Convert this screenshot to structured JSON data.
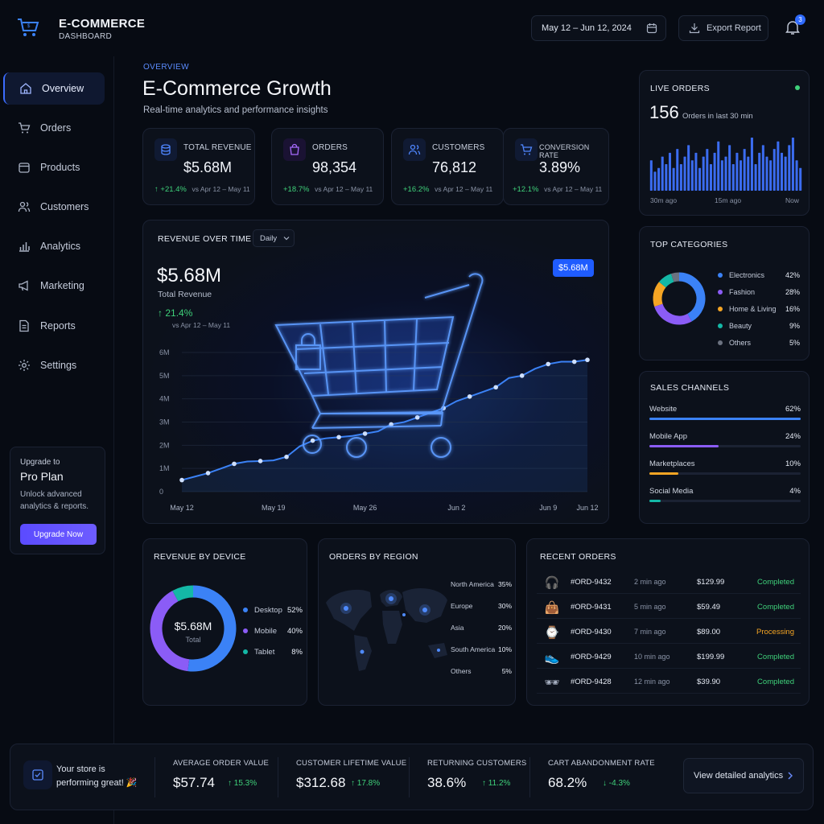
{
  "header": {
    "brand": "E-COMMERCE",
    "brand_sub": "DASHBOARD",
    "date_range": "May 12 – Jun 12, 2024",
    "export_label": "Export Report",
    "notif_count": "3"
  },
  "sidebar": {
    "items": [
      {
        "label": "Overview",
        "icon": "home-icon"
      },
      {
        "label": "Orders",
        "icon": "cart-icon"
      },
      {
        "label": "Products",
        "icon": "box-icon"
      },
      {
        "label": "Customers",
        "icon": "users-icon"
      },
      {
        "label": "Analytics",
        "icon": "bar-chart-icon"
      },
      {
        "label": "Marketing",
        "icon": "megaphone-icon"
      },
      {
        "label": "Reports",
        "icon": "document-icon"
      },
      {
        "label": "Settings",
        "icon": "gear-icon"
      }
    ],
    "promo": {
      "line1": "Upgrade to",
      "title": "Pro Plan",
      "desc1": "Unlock advanced",
      "desc2": "analytics & reports.",
      "button": "Upgrade Now"
    }
  },
  "overview": {
    "eyebrow": "OVERVIEW",
    "title": "E-Commerce Growth",
    "subtitle": "Real-time analytics and performance insights"
  },
  "kpis": [
    {
      "label": "TOTAL REVENUE",
      "value": "$5.68M",
      "change": "+21.4%",
      "period": "vs Apr 12 – May 11",
      "icon": "coins-icon",
      "color": "#3b82f6"
    },
    {
      "label": "ORDERS",
      "value": "98,354",
      "change": "+18.7%",
      "period": "vs Apr 12 – May 11",
      "icon": "bag-icon",
      "color": "#a855f7"
    },
    {
      "label": "CUSTOMERS",
      "value": "76,812",
      "change": "+16.2%",
      "period": "vs Apr 12 – May 11",
      "icon": "users-icon",
      "color": "#3b82f6"
    },
    {
      "label": "CONVERSION RATE",
      "value": "3.89%",
      "change": "+12.1%",
      "period": "vs Apr 12 – May 11",
      "icon": "cart-icon",
      "color": "#3b82f6"
    }
  ],
  "revenue": {
    "title": "REVENUE OVER TIME",
    "dropdown": "Daily",
    "value": "$5.68M",
    "value_label": "Total Revenue",
    "change": "21.4%",
    "period": "vs Apr 12 – May 11",
    "tooltip": "$5.68M"
  },
  "chart_data": {
    "type": "line",
    "title": "REVENUE OVER TIME",
    "x": [
      "May 12",
      "May 13",
      "May 14",
      "May 15",
      "May 16",
      "May 17",
      "May 18",
      "May 19",
      "May 20",
      "May 21",
      "May 22",
      "May 23",
      "May 24",
      "May 25",
      "May 26",
      "May 27",
      "May 28",
      "May 29",
      "May 30",
      "May 31",
      "Jun 1",
      "Jun 2",
      "Jun 3",
      "Jun 4",
      "Jun 5",
      "Jun 6",
      "Jun 7",
      "Jun 8",
      "Jun 9",
      "Jun 10",
      "Jun 11",
      "Jun 12"
    ],
    "y": [
      0.5,
      0.65,
      0.8,
      1.0,
      1.2,
      1.3,
      1.32,
      1.35,
      1.5,
      1.95,
      2.2,
      2.3,
      2.35,
      2.4,
      2.5,
      2.6,
      2.9,
      3.0,
      3.2,
      3.4,
      3.6,
      3.9,
      4.1,
      4.3,
      4.5,
      4.9,
      5.0,
      5.3,
      5.5,
      5.6,
      5.6,
      5.68
    ],
    "x_ticks": [
      "May 12",
      "May 19",
      "May 26",
      "Jun 2",
      "Jun 9",
      "Jun 12"
    ],
    "y_ticks": [
      "0",
      "1M",
      "2M",
      "3M",
      "4M",
      "5M",
      "6M"
    ],
    "ylim": [
      0,
      6
    ],
    "xlabel": "",
    "ylabel": "",
    "grid": true,
    "color": "#3b82f6"
  },
  "live_orders": {
    "title": "LIVE ORDERS",
    "count": "156",
    "count_label": "Orders in last 30 min",
    "bars": [
      8,
      5,
      6,
      9,
      7,
      10,
      6,
      11,
      7,
      9,
      12,
      8,
      10,
      6,
      9,
      11,
      7,
      10,
      13,
      8,
      9,
      12,
      7,
      10,
      8,
      11,
      9,
      14,
      7,
      10,
      12,
      9,
      8,
      11,
      13,
      10,
      9,
      12,
      14,
      8,
      6
    ],
    "x_labels": [
      "30m ago",
      "15m ago",
      "Now"
    ]
  },
  "top_categories": {
    "title": "TOP CATEGORIES",
    "items": [
      {
        "name": "Electronics",
        "pct": "42%",
        "value": 42,
        "color": "#3b82f6"
      },
      {
        "name": "Fashion",
        "pct": "28%",
        "value": 28,
        "color": "#8b5cf6"
      },
      {
        "name": "Home & Living",
        "pct": "16%",
        "value": 16,
        "color": "#f5a524"
      },
      {
        "name": "Beauty",
        "pct": "9%",
        "value": 9,
        "color": "#14b8a6"
      },
      {
        "name": "Others",
        "pct": "5%",
        "value": 5,
        "color": "#6b7280"
      }
    ]
  },
  "sales_channels": {
    "title": "SALES CHANNELS",
    "items": [
      {
        "name": "Website",
        "pct": "62%",
        "value": 62,
        "color": "#3b82f6"
      },
      {
        "name": "Mobile App",
        "pct": "24%",
        "value": 24,
        "color": "#8b5cf6"
      },
      {
        "name": "Marketplaces",
        "pct": "10%",
        "value": 10,
        "color": "#f5a524"
      },
      {
        "name": "Social Media",
        "pct": "4%",
        "value": 4,
        "color": "#14b8a6"
      }
    ]
  },
  "revenue_by_device": {
    "title": "REVENUE BY DEVICE",
    "center_value": "$5.68M",
    "center_label": "Total",
    "items": [
      {
        "name": "Desktop",
        "pct": "52%",
        "value": 52,
        "color": "#3b82f6"
      },
      {
        "name": "Mobile",
        "pct": "40%",
        "value": 40,
        "color": "#8b5cf6"
      },
      {
        "name": "Tablet",
        "pct": "8%",
        "value": 8,
        "color": "#14b8a6"
      }
    ]
  },
  "orders_by_region": {
    "title": "ORDERS BY REGION",
    "items": [
      {
        "name": "North America",
        "pct": "35%"
      },
      {
        "name": "Europe",
        "pct": "30%"
      },
      {
        "name": "Asia",
        "pct": "20%"
      },
      {
        "name": "South America",
        "pct": "10%"
      },
      {
        "name": "Others",
        "pct": "5%"
      }
    ]
  },
  "recent_orders": {
    "title": "RECENT ORDERS",
    "rows": [
      {
        "id": "#ORD-9432",
        "time": "2 min ago",
        "amount": "$129.99",
        "status": "Completed",
        "status_color": "#3fd17a",
        "icon": "headphones-icon"
      },
      {
        "id": "#ORD-9431",
        "time": "5 min ago",
        "amount": "$59.49",
        "status": "Completed",
        "status_color": "#3fd17a",
        "icon": "shopping-bag-icon"
      },
      {
        "id": "#ORD-9430",
        "time": "7 min ago",
        "amount": "$89.00",
        "status": "Processing",
        "status_color": "#f5a524",
        "icon": "watch-icon"
      },
      {
        "id": "#ORD-9429",
        "time": "10 min ago",
        "amount": "$199.99",
        "status": "Completed",
        "status_color": "#3fd17a",
        "icon": "sneaker-icon"
      },
      {
        "id": "#ORD-9428",
        "time": "12 min ago",
        "amount": "$39.90",
        "status": "Completed",
        "status_color": "#3fd17a",
        "icon": "sunglasses-icon"
      }
    ]
  },
  "footer": {
    "message1": "Your store is",
    "message2": "performing great! 🎉",
    "stats": [
      {
        "label": "AVERAGE ORDER VALUE",
        "value": "$57.74",
        "change": "↑ 15.3%"
      },
      {
        "label": "CUSTOMER LIFETIME VALUE",
        "value": "$312.68",
        "change": "↑ 17.8%"
      },
      {
        "label": "RETURNING CUSTOMERS",
        "value": "38.6%",
        "change": "↑ 11.2%"
      },
      {
        "label": "CART ABANDONMENT RATE",
        "value": "68.2%",
        "change": "↓ -4.3%"
      }
    ],
    "cta": "View detailed analytics"
  }
}
